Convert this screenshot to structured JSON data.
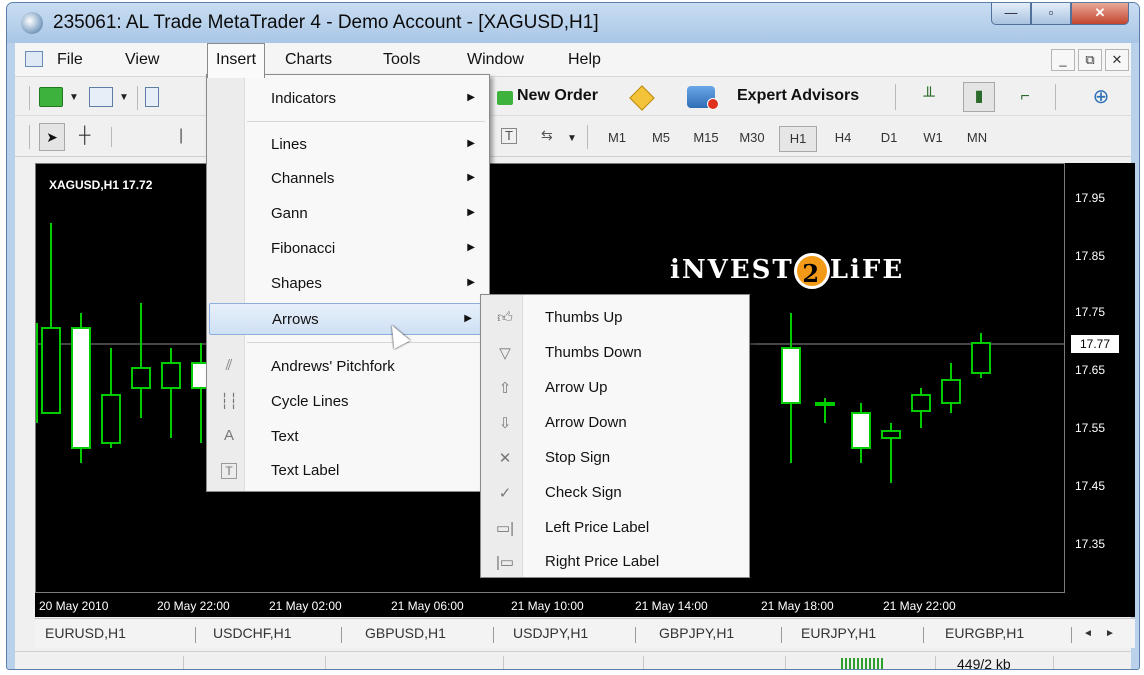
{
  "window": {
    "title": "235061: AL Trade MetaTrader 4 - Demo Account - [XAGUSD,H1]",
    "controls": [
      "—",
      "▫",
      "✕"
    ]
  },
  "menubar": {
    "items": [
      "File",
      "View",
      "Insert",
      "Charts",
      "Tools",
      "Window",
      "Help"
    ],
    "active": "Insert",
    "mdi_controls": [
      "_",
      "⧉",
      "✕"
    ]
  },
  "toolbar": {
    "new_order": "New Order",
    "expert_advisors": "Expert Advisors",
    "chart_type_buttons": [
      "bar-chart-icon",
      "candlestick-icon",
      "line-chart-icon"
    ],
    "pressed_chart_type": "candlestick-icon",
    "zoom": "zoom-in-icon"
  },
  "timeframes": {
    "items": [
      "M1",
      "M5",
      "M15",
      "M30",
      "H1",
      "H4",
      "D1",
      "W1",
      "MN"
    ],
    "selected": "H1"
  },
  "chart": {
    "label": "XAGUSD,H1  17.72",
    "price_ticks": [
      "17.95",
      "17.85",
      "17.75",
      "17.65",
      "17.55",
      "17.45",
      "17.35"
    ],
    "current_price": "17.77",
    "time_ticks": [
      "20 May 2010",
      "20 May 22:00",
      "21 May 02:00",
      "21 May 06:00",
      "21 May 10:00",
      "21 May 14:00",
      "21 May 18:00",
      "21 May 22:00"
    ],
    "logo_left": "iNVEST",
    "logo_mid": "2",
    "logo_right": "LiFE",
    "colors": {
      "background": "#000000",
      "candle": "#00cc00",
      "bull_body": "#000000",
      "bear_body": "#ffffff"
    }
  },
  "insert_menu": {
    "items": [
      {
        "label": "Indicators",
        "submenu": true,
        "icon": ""
      },
      {
        "label": "Lines",
        "submenu": true,
        "icon": ""
      },
      {
        "label": "Channels",
        "submenu": true,
        "icon": ""
      },
      {
        "label": "Gann",
        "submenu": true,
        "icon": ""
      },
      {
        "label": "Fibonacci",
        "submenu": true,
        "icon": ""
      },
      {
        "label": "Shapes",
        "submenu": true,
        "icon": ""
      },
      {
        "label": "Arrows",
        "submenu": true,
        "icon": "",
        "highlighted": true
      },
      {
        "label": "Andrews' Pitchfork",
        "submenu": false,
        "icon": "pitchfork-icon"
      },
      {
        "label": "Cycle Lines",
        "submenu": false,
        "icon": "cycle-lines-icon"
      },
      {
        "label": "Text",
        "submenu": false,
        "icon": "text-icon"
      },
      {
        "label": "Text Label",
        "submenu": false,
        "icon": "text-label-icon"
      }
    ]
  },
  "arrows_menu": {
    "items": [
      {
        "label": "Thumbs Up",
        "icon": "thumbs-up-icon"
      },
      {
        "label": "Thumbs Down",
        "icon": "thumbs-down-icon"
      },
      {
        "label": "Arrow Up",
        "icon": "arrow-up-icon"
      },
      {
        "label": "Arrow Down",
        "icon": "arrow-down-icon"
      },
      {
        "label": "Stop Sign",
        "icon": "stop-sign-icon"
      },
      {
        "label": "Check Sign",
        "icon": "check-sign-icon"
      },
      {
        "label": "Left Price Label",
        "icon": "left-price-label-icon"
      },
      {
        "label": "Right Price Label",
        "icon": "right-price-label-icon"
      }
    ]
  },
  "symbol_tabs": [
    "EURUSD,H1",
    "USDCHF,H1",
    "GBPUSD,H1",
    "USDJPY,H1",
    "GBPJPY,H1",
    "EURJPY,H1",
    "EURGBP,H1"
  ],
  "status": {
    "traffic": "449/2 kb"
  }
}
